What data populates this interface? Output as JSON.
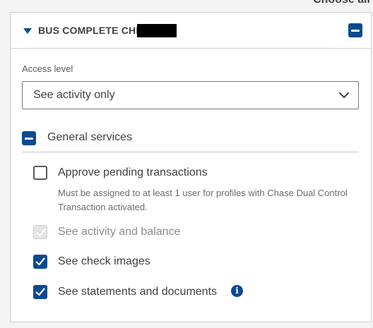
{
  "page": {
    "top_text": "Choose all"
  },
  "account": {
    "name": "BUS COMPLETE CHK",
    "expanded": true
  },
  "access": {
    "label": "Access level",
    "selected": "See activity only"
  },
  "group": {
    "label": "General services"
  },
  "options": [
    {
      "label": "Approve pending transactions",
      "help": "Must be assigned to at least 1 user for profiles with Chase Dual Control Transaction activated.",
      "checked": false,
      "disabled": false
    },
    {
      "label": "See activity and balance",
      "checked": true,
      "disabled": true
    },
    {
      "label": "See check images",
      "checked": true,
      "disabled": false
    },
    {
      "label": "See statements and documents",
      "checked": true,
      "disabled": false
    }
  ],
  "icons": {
    "header_toggle": "minus-square-icon",
    "expand": "caret-down-icon",
    "select": "chevron-down-icon",
    "info": "info-circle-icon"
  },
  "colors": {
    "accent": "#0a4b8f",
    "text": "#414042",
    "border": "#d0d0d0"
  }
}
